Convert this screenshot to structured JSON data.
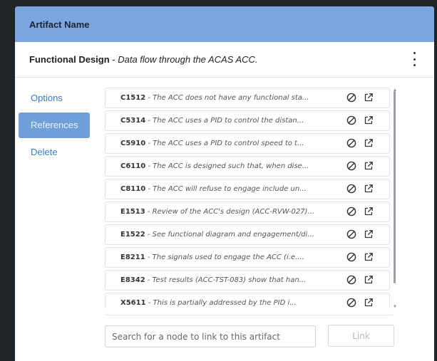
{
  "header": {
    "title": "Artifact Name"
  },
  "artifact": {
    "name": "Functional Design",
    "separator": " - ",
    "description": "Data flow through the ACAS ACC."
  },
  "nav": {
    "items": [
      {
        "label": "Options"
      },
      {
        "label": "References"
      },
      {
        "label": "Delete"
      }
    ],
    "active": "References"
  },
  "references": [
    {
      "code": "C1512",
      "text": "The ACC does not have any functional sta..."
    },
    {
      "code": "C5314",
      "text": "The ACC uses a PID to control the distan..."
    },
    {
      "code": "C5910",
      "text": "The ACC uses a PID to control speed to t..."
    },
    {
      "code": "C6110",
      "text": "The ACC is designed such that, when dise..."
    },
    {
      "code": "C8110",
      "text": "The ACC will refuse to engage include un..."
    },
    {
      "code": "E1513",
      "text": "Review of the ACC's design (ACC-RVW-027)..."
    },
    {
      "code": "E1522",
      "text": "See functional diagram and engagement/di..."
    },
    {
      "code": "E8211",
      "text": "The signals used to engage the ACC (i.e...."
    },
    {
      "code": "E8342",
      "text": "Test results (ACC-TST-083) show that han..."
    },
    {
      "code": "X5611",
      "text": "This is partially addressed by the PID i..."
    }
  ],
  "search": {
    "placeholder": "Search for a node to link to this artifact",
    "value": ""
  },
  "link_button": {
    "label": "Link"
  },
  "icons": {
    "remove": "block-icon",
    "open": "external-link-icon",
    "menu": "kebab-menu-icon"
  }
}
